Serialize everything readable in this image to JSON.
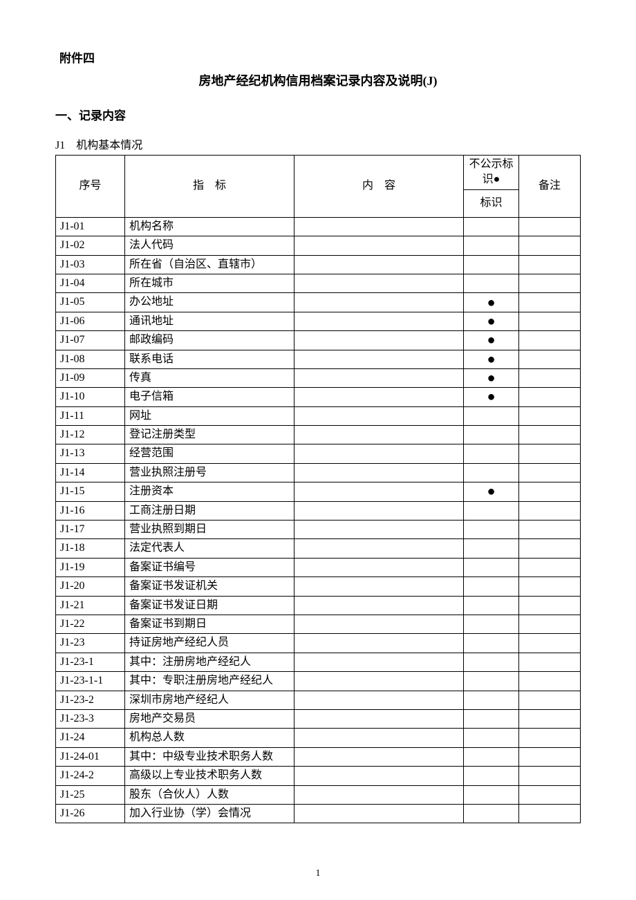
{
  "attachment_label": "附件四",
  "title": "房地产经纪机构信用档案记录内容及说明(J)",
  "section1": "一、记录内容",
  "caption": "J1　机构基本情况",
  "headers": {
    "seq": "序号",
    "indicator": "指　标",
    "content": "内　容",
    "flag_top": "不公示标识●",
    "flag_bottom": "标识",
    "note": "备注"
  },
  "rows": [
    {
      "seq": "J1-01",
      "ind": "机构名称",
      "flag": ""
    },
    {
      "seq": "J1-02",
      "ind": "法人代码",
      "flag": ""
    },
    {
      "seq": "J1-03",
      "ind": "所在省（自治区、直辖市）",
      "flag": ""
    },
    {
      "seq": "J1-04",
      "ind": "所在城市",
      "flag": ""
    },
    {
      "seq": "J1-05",
      "ind": "办公地址",
      "flag": "●"
    },
    {
      "seq": "J1-06",
      "ind": "通讯地址",
      "flag": "●"
    },
    {
      "seq": "J1-07",
      "ind": "邮政编码",
      "flag": "●"
    },
    {
      "seq": "J1-08",
      "ind": "联系电话",
      "flag": "●"
    },
    {
      "seq": "J1-09",
      "ind": "传真",
      "flag": "●"
    },
    {
      "seq": "J1-10",
      "ind": "电子信箱",
      "flag": "●"
    },
    {
      "seq": "J1-11",
      "ind": "网址",
      "flag": ""
    },
    {
      "seq": "J1-12",
      "ind": "登记注册类型",
      "flag": ""
    },
    {
      "seq": "J1-13",
      "ind": "经营范围",
      "flag": ""
    },
    {
      "seq": "J1-14",
      "ind": "营业执照注册号",
      "flag": ""
    },
    {
      "seq": "J1-15",
      "ind": "注册资本",
      "flag": "●"
    },
    {
      "seq": "J1-16",
      "ind": "工商注册日期",
      "flag": ""
    },
    {
      "seq": "J1-17",
      "ind": "营业执照到期日",
      "flag": ""
    },
    {
      "seq": "J1-18",
      "ind": "法定代表人",
      "flag": ""
    },
    {
      "seq": "J1-19",
      "ind": "备案证书编号",
      "flag": ""
    },
    {
      "seq": "J1-20",
      "ind": "备案证书发证机关",
      "flag": ""
    },
    {
      "seq": "J1-21",
      "ind": "备案证书发证日期",
      "flag": ""
    },
    {
      "seq": "J1-22",
      "ind": "备案证书到期日",
      "flag": ""
    },
    {
      "seq": "J1-23",
      "ind": "持证房地产经纪人员",
      "flag": ""
    },
    {
      "seq": "J1-23-1",
      "ind": "其中：注册房地产经纪人",
      "flag": ""
    },
    {
      "seq": "J1-23-1-1",
      "ind": "其中：专职注册房地产经纪人",
      "flag": ""
    },
    {
      "seq": "J1-23-2",
      "ind": "深圳市房地产经纪人",
      "flag": ""
    },
    {
      "seq": "J1-23-3",
      "ind": "房地产交易员",
      "flag": ""
    },
    {
      "seq": "J1-24",
      "ind": "机构总人数",
      "flag": ""
    },
    {
      "seq": "J1-24-01",
      "ind": "其中：中级专业技术职务人数",
      "flag": ""
    },
    {
      "seq": "J1-24-2",
      "ind": "高级以上专业技术职务人数",
      "flag": ""
    },
    {
      "seq": "J1-25",
      "ind": "股东（合伙人）人数",
      "flag": ""
    },
    {
      "seq": "J1-26",
      "ind": "加入行业协（学）会情况",
      "flag": ""
    }
  ],
  "page_number": "1"
}
